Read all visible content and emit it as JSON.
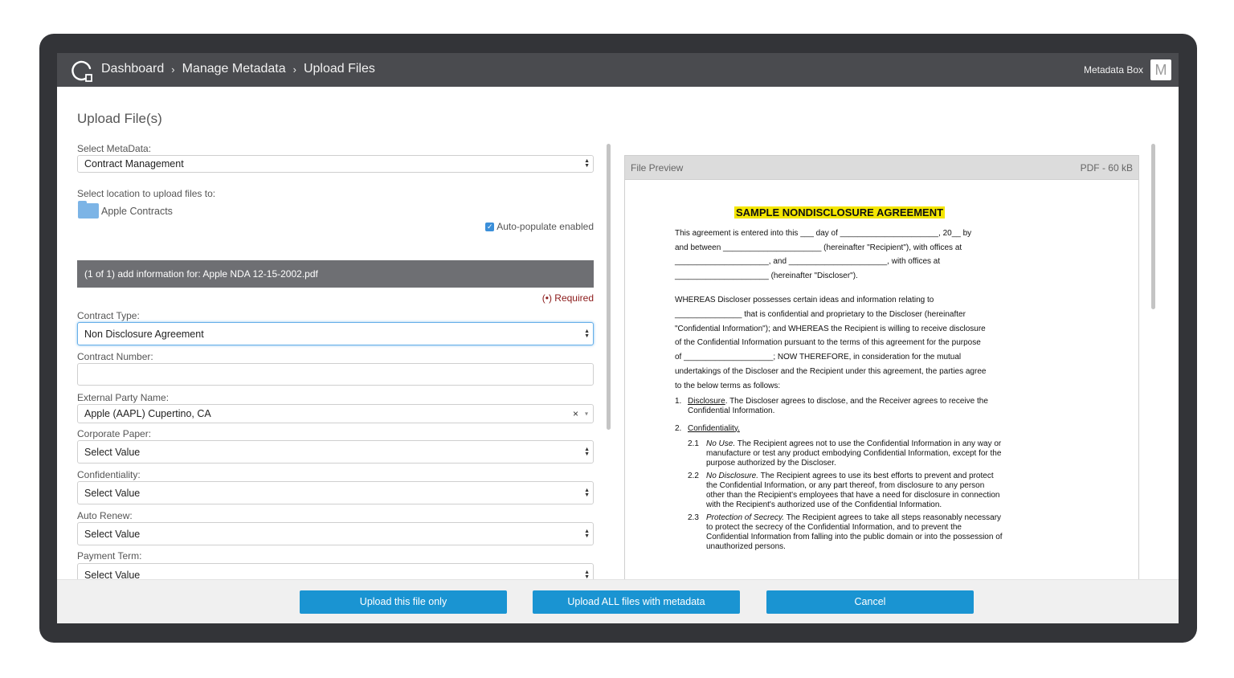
{
  "nav": {
    "breadcrumbs": [
      "Dashboard",
      "Manage Metadata",
      "Upload Files"
    ],
    "separator": "›",
    "account_name": "Metadata Box",
    "avatar_letter": "M"
  },
  "page": {
    "title": "Upload File(s)"
  },
  "upload": {
    "metadata_label": "Select MetaData:",
    "metadata_value": "Contract Management",
    "location_label": "Select location to upload files to:",
    "location_folder": "Apple Contracts",
    "autopopulate_label": "Auto-populate enabled",
    "autopopulate_checked": true,
    "file_header": "(1 of 1) add information for: Apple NDA 12-15-2002.pdf",
    "required_note": "(•) Required"
  },
  "fields": {
    "contract_type": {
      "label": "Contract Type:",
      "value": "Non Disclosure Agreement"
    },
    "contract_number": {
      "label": "Contract Number:",
      "value": ""
    },
    "external_party": {
      "label": "External Party Name:",
      "value": "Apple (AAPL) Cupertino, CA",
      "clear": "×",
      "caret": "▾"
    },
    "corporate_paper": {
      "label": "Corporate Paper:",
      "value": "Select Value"
    },
    "confidentiality": {
      "label": "Confidentiality:",
      "value": "Select Value"
    },
    "auto_renew": {
      "label": "Auto Renew:",
      "value": "Select Value"
    },
    "payment_term": {
      "label": "Payment Term:",
      "value": "Select Value"
    }
  },
  "preview": {
    "header_label": "File Preview",
    "file_info": "PDF - 60 kB",
    "doc_title": "SAMPLE NONDISCLOSURE AGREEMENT",
    "intro_lines": [
      "This agreement is entered into this ___ day of ______________________, 20__ by",
      "and between ______________________ (hereinafter \"Recipient\"), with offices at",
      "_____________________, and ______________________, with offices at",
      "_____________________ (hereinafter \"Discloser\")."
    ],
    "whereas_lines": [
      "WHEREAS Discloser possesses certain ideas and information relating to",
      "_______________ that is confidential and proprietary to the Discloser (hereinafter",
      "\"Confidential Information\"); and WHEREAS the Recipient is willing to receive disclosure",
      "of the Confidential Information pursuant to the terms of this agreement for the purpose",
      "of ____________________; NOW THEREFORE, in consideration for the mutual",
      "undertakings of the Discloser and the Recipient under this agreement, the parties agree",
      "to the below terms as follows:"
    ],
    "item1_num": "1.",
    "item1_title": "Disclosure",
    "item1_text": ".  The Discloser agrees to disclose, and the Receiver agrees to receive the Confidential Information.",
    "item2_num": "2.",
    "item2_title": "Confidentiality.",
    "sub1_num": "2.1",
    "sub1_title": "No Use.",
    "sub1_text": "  The Recipient agrees not to use the Confidential Information in any way or manufacture or test any product embodying Confidential Information, except for the purpose authorized by the Discloser.",
    "sub2_num": "2.2",
    "sub2_title": "No Disclosure.",
    "sub2_text": "  The Recipient agrees to use its best efforts to prevent and protect the Confidential Information, or any part thereof, from disclosure to any person other than the Recipient's employees that have a need for disclosure in connection with the Recipient's authorized use of the Confidential Information.",
    "sub3_num": "2.3",
    "sub3_title": "Protection of Secrecy.",
    "sub3_text": "  The Recipient agrees to take all steps reasonably necessary to protect the secrecy of the Confidential Information, and to prevent the Confidential Information from falling into the public domain or into the possession of unauthorized persons."
  },
  "footer": {
    "upload_one": "Upload this file only",
    "upload_all": "Upload ALL files with metadata",
    "cancel": "Cancel"
  },
  "colors": {
    "topbar": "#4a4b4f",
    "frame": "#333438",
    "primary_button": "#1a94d2",
    "file_header": "#6e6f73",
    "required": "#8b1a1a",
    "highlight": "#f4e600"
  }
}
